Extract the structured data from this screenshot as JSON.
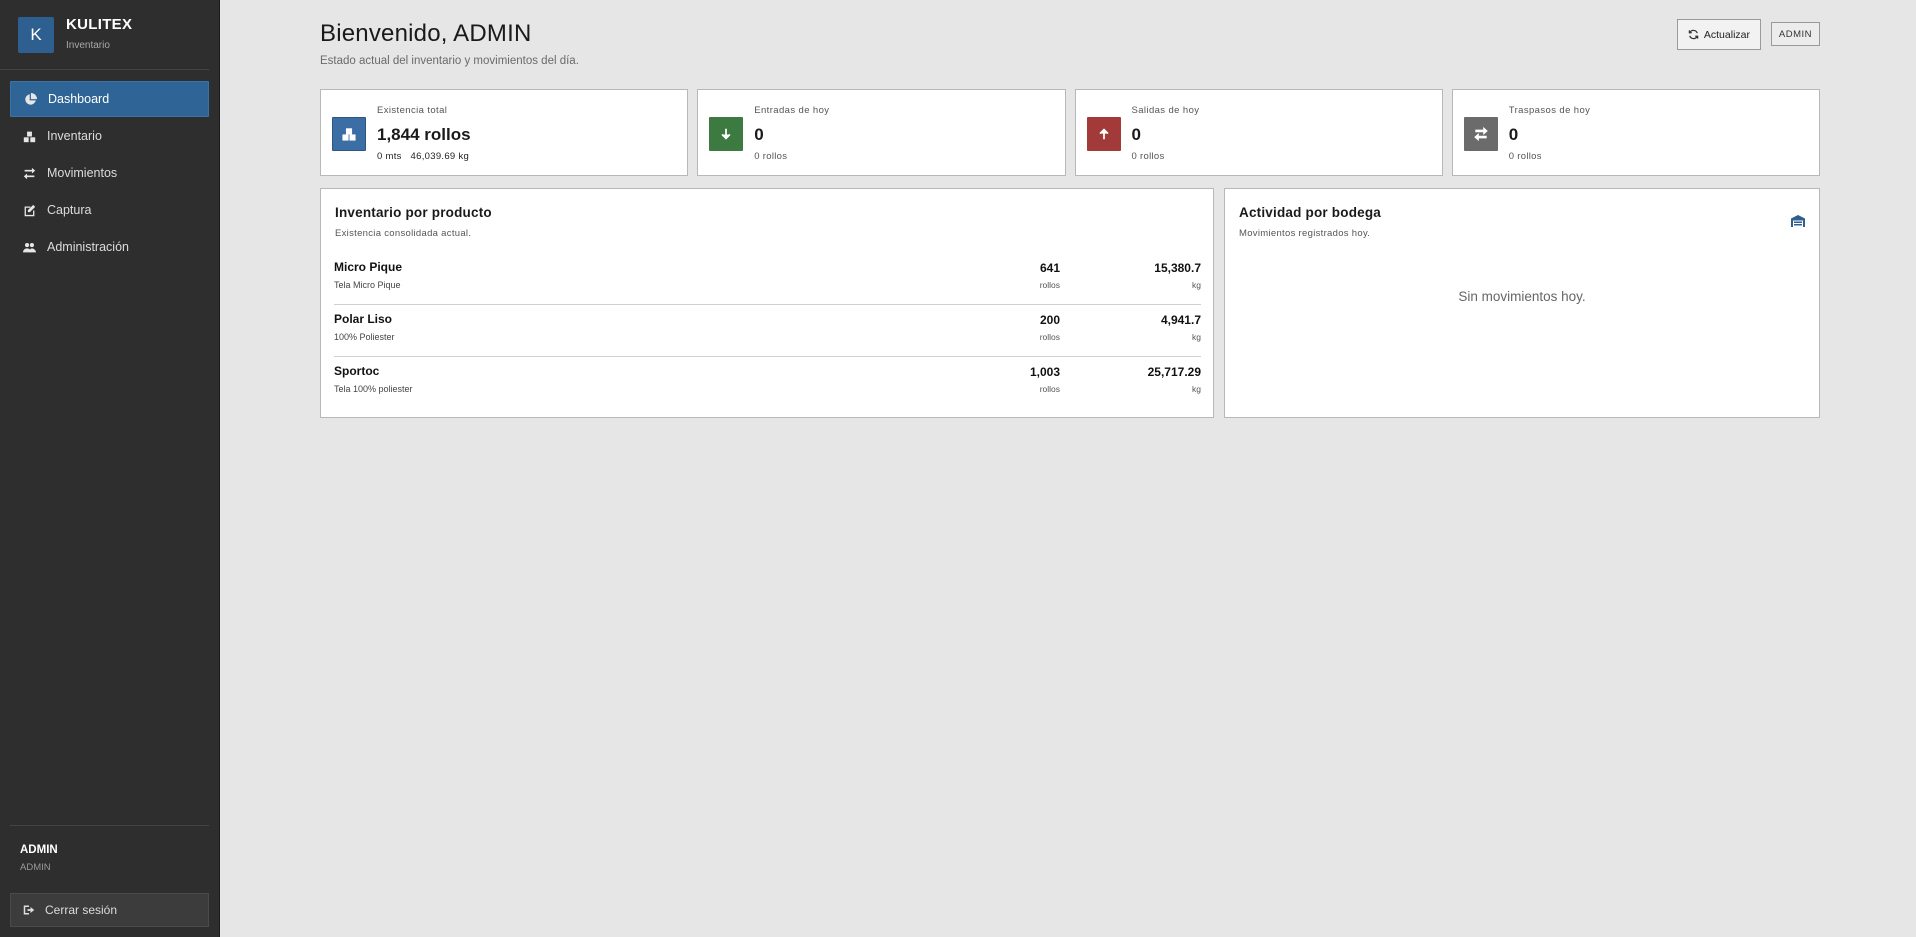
{
  "brand": {
    "logo_letter": "K",
    "name": "KULITEX",
    "subtitle": "Inventario"
  },
  "nav": {
    "items": [
      {
        "label": "Dashboard",
        "icon": "pie-chart-icon",
        "active": true
      },
      {
        "label": "Inventario",
        "icon": "boxes-icon"
      },
      {
        "label": "Movimientos",
        "icon": "exchange-icon"
      },
      {
        "label": "Captura",
        "icon": "edit-icon"
      },
      {
        "label": "Administración",
        "icon": "users-icon"
      }
    ]
  },
  "user": {
    "name": "ADMIN",
    "role": "ADMIN",
    "logout_label": "Cerrar sesión"
  },
  "header": {
    "title": "Bienvenido, ADMIN",
    "subtitle": "Estado actual del inventario y movimientos del día.",
    "refresh_label": "Actualizar",
    "user_badge": "ADMIN"
  },
  "stats": [
    {
      "label": "Existencia total",
      "value": "1,844 rollos",
      "sub": "0 mts   46,039.69 kg",
      "color": "#3a6ea5",
      "icon": "boxes-icon"
    },
    {
      "label": "Entradas de hoy",
      "value": "0",
      "sub": "0 rollos",
      "color": "#3d7a42",
      "icon": "arrow-down-icon"
    },
    {
      "label": "Salidas de hoy",
      "value": "0",
      "sub": "0 rollos",
      "color": "#a33a3a",
      "icon": "arrow-up-icon"
    },
    {
      "label": "Traspasos de hoy",
      "value": "0",
      "sub": "0 rollos",
      "color": "#6b6b6b",
      "icon": "exchange-icon"
    }
  ],
  "products_panel": {
    "title": "Inventario por producto",
    "subtitle": "Existencia consolidada actual.",
    "rows": [
      {
        "name": "Micro Pique",
        "desc": "Tela Micro Pique",
        "qty": "641",
        "qty_unit": "rollos",
        "kg": "15,380.7",
        "kg_unit": "kg"
      },
      {
        "name": "Polar Liso",
        "desc": "100% Poliester",
        "qty": "200",
        "qty_unit": "rollos",
        "kg": "4,941.7",
        "kg_unit": "kg"
      },
      {
        "name": "Sportoc",
        "desc": "Tela 100% poliester",
        "qty": "1,003",
        "qty_unit": "rollos",
        "kg": "25,717.29",
        "kg_unit": "kg"
      }
    ]
  },
  "warehouse_panel": {
    "title": "Actividad por bodega",
    "subtitle": "Movimientos registrados hoy.",
    "empty": "Sin movimientos hoy.",
    "icon": "warehouse-icon"
  }
}
